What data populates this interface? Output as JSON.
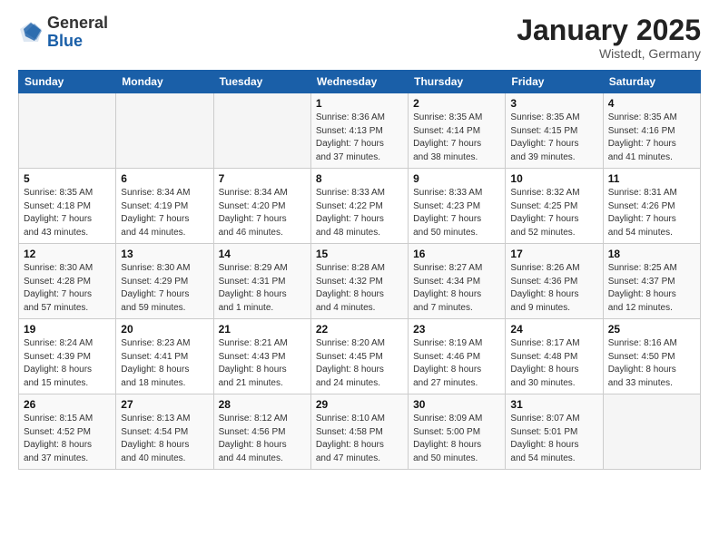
{
  "logo": {
    "general": "General",
    "blue": "Blue"
  },
  "title": "January 2025",
  "location": "Wistedt, Germany",
  "days_header": [
    "Sunday",
    "Monday",
    "Tuesday",
    "Wednesday",
    "Thursday",
    "Friday",
    "Saturday"
  ],
  "weeks": [
    [
      {
        "day": "",
        "info": ""
      },
      {
        "day": "",
        "info": ""
      },
      {
        "day": "",
        "info": ""
      },
      {
        "day": "1",
        "info": "Sunrise: 8:36 AM\nSunset: 4:13 PM\nDaylight: 7 hours\nand 37 minutes."
      },
      {
        "day": "2",
        "info": "Sunrise: 8:35 AM\nSunset: 4:14 PM\nDaylight: 7 hours\nand 38 minutes."
      },
      {
        "day": "3",
        "info": "Sunrise: 8:35 AM\nSunset: 4:15 PM\nDaylight: 7 hours\nand 39 minutes."
      },
      {
        "day": "4",
        "info": "Sunrise: 8:35 AM\nSunset: 4:16 PM\nDaylight: 7 hours\nand 41 minutes."
      }
    ],
    [
      {
        "day": "5",
        "info": "Sunrise: 8:35 AM\nSunset: 4:18 PM\nDaylight: 7 hours\nand 43 minutes."
      },
      {
        "day": "6",
        "info": "Sunrise: 8:34 AM\nSunset: 4:19 PM\nDaylight: 7 hours\nand 44 minutes."
      },
      {
        "day": "7",
        "info": "Sunrise: 8:34 AM\nSunset: 4:20 PM\nDaylight: 7 hours\nand 46 minutes."
      },
      {
        "day": "8",
        "info": "Sunrise: 8:33 AM\nSunset: 4:22 PM\nDaylight: 7 hours\nand 48 minutes."
      },
      {
        "day": "9",
        "info": "Sunrise: 8:33 AM\nSunset: 4:23 PM\nDaylight: 7 hours\nand 50 minutes."
      },
      {
        "day": "10",
        "info": "Sunrise: 8:32 AM\nSunset: 4:25 PM\nDaylight: 7 hours\nand 52 minutes."
      },
      {
        "day": "11",
        "info": "Sunrise: 8:31 AM\nSunset: 4:26 PM\nDaylight: 7 hours\nand 54 minutes."
      }
    ],
    [
      {
        "day": "12",
        "info": "Sunrise: 8:30 AM\nSunset: 4:28 PM\nDaylight: 7 hours\nand 57 minutes."
      },
      {
        "day": "13",
        "info": "Sunrise: 8:30 AM\nSunset: 4:29 PM\nDaylight: 7 hours\nand 59 minutes."
      },
      {
        "day": "14",
        "info": "Sunrise: 8:29 AM\nSunset: 4:31 PM\nDaylight: 8 hours\nand 1 minute."
      },
      {
        "day": "15",
        "info": "Sunrise: 8:28 AM\nSunset: 4:32 PM\nDaylight: 8 hours\nand 4 minutes."
      },
      {
        "day": "16",
        "info": "Sunrise: 8:27 AM\nSunset: 4:34 PM\nDaylight: 8 hours\nand 7 minutes."
      },
      {
        "day": "17",
        "info": "Sunrise: 8:26 AM\nSunset: 4:36 PM\nDaylight: 8 hours\nand 9 minutes."
      },
      {
        "day": "18",
        "info": "Sunrise: 8:25 AM\nSunset: 4:37 PM\nDaylight: 8 hours\nand 12 minutes."
      }
    ],
    [
      {
        "day": "19",
        "info": "Sunrise: 8:24 AM\nSunset: 4:39 PM\nDaylight: 8 hours\nand 15 minutes."
      },
      {
        "day": "20",
        "info": "Sunrise: 8:23 AM\nSunset: 4:41 PM\nDaylight: 8 hours\nand 18 minutes."
      },
      {
        "day": "21",
        "info": "Sunrise: 8:21 AM\nSunset: 4:43 PM\nDaylight: 8 hours\nand 21 minutes."
      },
      {
        "day": "22",
        "info": "Sunrise: 8:20 AM\nSunset: 4:45 PM\nDaylight: 8 hours\nand 24 minutes."
      },
      {
        "day": "23",
        "info": "Sunrise: 8:19 AM\nSunset: 4:46 PM\nDaylight: 8 hours\nand 27 minutes."
      },
      {
        "day": "24",
        "info": "Sunrise: 8:17 AM\nSunset: 4:48 PM\nDaylight: 8 hours\nand 30 minutes."
      },
      {
        "day": "25",
        "info": "Sunrise: 8:16 AM\nSunset: 4:50 PM\nDaylight: 8 hours\nand 33 minutes."
      }
    ],
    [
      {
        "day": "26",
        "info": "Sunrise: 8:15 AM\nSunset: 4:52 PM\nDaylight: 8 hours\nand 37 minutes."
      },
      {
        "day": "27",
        "info": "Sunrise: 8:13 AM\nSunset: 4:54 PM\nDaylight: 8 hours\nand 40 minutes."
      },
      {
        "day": "28",
        "info": "Sunrise: 8:12 AM\nSunset: 4:56 PM\nDaylight: 8 hours\nand 44 minutes."
      },
      {
        "day": "29",
        "info": "Sunrise: 8:10 AM\nSunset: 4:58 PM\nDaylight: 8 hours\nand 47 minutes."
      },
      {
        "day": "30",
        "info": "Sunrise: 8:09 AM\nSunset: 5:00 PM\nDaylight: 8 hours\nand 50 minutes."
      },
      {
        "day": "31",
        "info": "Sunrise: 8:07 AM\nSunset: 5:01 PM\nDaylight: 8 hours\nand 54 minutes."
      },
      {
        "day": "",
        "info": ""
      }
    ]
  ]
}
